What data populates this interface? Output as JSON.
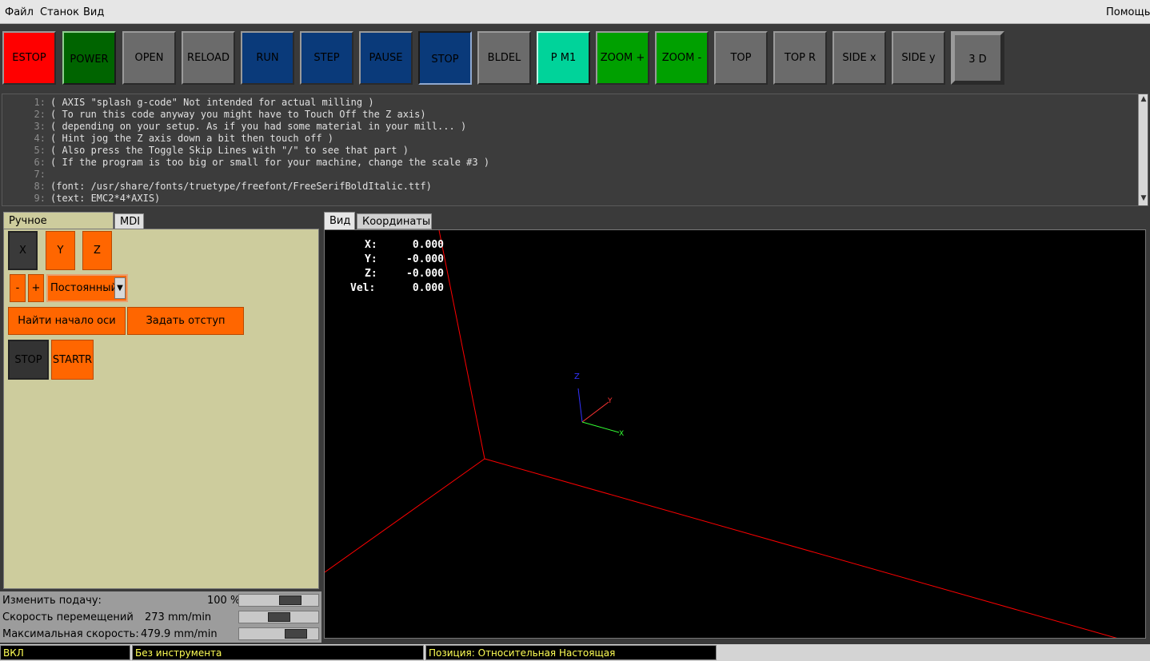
{
  "menu": {
    "left": [
      "Файл",
      "Станок",
      "Вид"
    ],
    "help": "Помощь"
  },
  "toolbar": [
    {
      "label": "ESTOP",
      "color": "#ff0000"
    },
    {
      "label": "POWER",
      "color": "#006400"
    },
    {
      "label": "OPEN",
      "color": "#6b6b6b"
    },
    {
      "label": "RELOAD",
      "color": "#6b6b6b"
    },
    {
      "label": "RUN",
      "color": "#0a3a7a"
    },
    {
      "label": "STEP",
      "color": "#0a3a7a"
    },
    {
      "label": "PAUSE",
      "color": "#0a3a7a"
    },
    {
      "label": "STOP",
      "color": "#0a3a7a"
    },
    {
      "label": "BLDEL",
      "color": "#6b6b6b"
    },
    {
      "label": "P M1",
      "color": "#00d39a"
    },
    {
      "label": "ZOOM +",
      "color": "#00a000"
    },
    {
      "label": "ZOOM -",
      "color": "#00a000"
    },
    {
      "label": "TOP",
      "color": "#6b6b6b"
    },
    {
      "label": "TOP R",
      "color": "#6b6b6b"
    },
    {
      "label": "SIDE x",
      "color": "#6b6b6b"
    },
    {
      "label": "SIDE y",
      "color": "#6b6b6b"
    },
    {
      "label": "3 D",
      "color": "#6b6b6b"
    }
  ],
  "gcode": [
    {
      "num": "1:",
      "text": "( AXIS \"splash g-code\" Not intended for actual milling )"
    },
    {
      "num": "2:",
      "text": "( To run this code anyway you might have to Touch Off the Z axis)"
    },
    {
      "num": "3:",
      "text": "( depending on your setup. As if you had some material in your mill... )"
    },
    {
      "num": "4:",
      "text": "( Hint jog the Z axis down a bit then touch off )"
    },
    {
      "num": "5:",
      "text": "( Also press the Toggle Skip Lines with \"/\" to see that part )"
    },
    {
      "num": "6:",
      "text": "( If the program is too big or small for your machine, change the scale #3 )"
    },
    {
      "num": "7:",
      "text": ""
    },
    {
      "num": "8:",
      "text": "(font: /usr/share/fonts/truetype/freefont/FreeSerifBoldItalic.ttf)"
    },
    {
      "num": "9:",
      "text": "(text: EMC2*4*AXIS)"
    }
  ],
  "left_tabs": {
    "manual": "Ручное управление",
    "mdi": "MDI"
  },
  "axes": [
    "X",
    "Y",
    "Z"
  ],
  "jog": {
    "minus": "-",
    "plus": "+",
    "mode": "Постоянный",
    "arrow": "▼"
  },
  "home_button": "Найти начало оси",
  "touchoff_button": "Задать отступ",
  "spindle": {
    "stop": "STOP",
    "start": "STARTR"
  },
  "sliders": [
    {
      "label": "Изменить подачу:",
      "value": "100 %",
      "level": 0.7
    },
    {
      "label": "Скорость перемещений",
      "value": "273 mm/min",
      "level": 0.5
    },
    {
      "label": "Максимальная скорость:",
      "value": "479.9 mm/min",
      "level": 0.8
    }
  ],
  "right_tabs": {
    "view": "Вид",
    "coords": "Координаты"
  },
  "dro": [
    {
      "label": "X:",
      "value": "0.000"
    },
    {
      "label": "Y:",
      "value": "-0.000"
    },
    {
      "label": "Z:",
      "value": "-0.000"
    },
    {
      "label": "Vel:",
      "value": "0.000"
    }
  ],
  "status": {
    "state": "ВКЛ",
    "tool": "Без инструмента",
    "position": "Позиция: Относительная Настоящая"
  },
  "colors": {
    "orange": "#ff6600",
    "panel": "#cdcc9d",
    "status_text": "#ffff55",
    "limit_lines": "#ff0000"
  }
}
